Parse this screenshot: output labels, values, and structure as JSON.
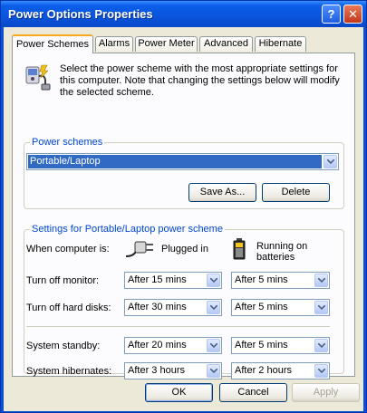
{
  "window": {
    "title": "Power Options Properties"
  },
  "tabs": [
    "Power Schemes",
    "Alarms",
    "Power Meter",
    "Advanced",
    "Hibernate"
  ],
  "intro_text": "Select the power scheme with the most appropriate settings for this computer. Note that changing the settings below will modify the selected scheme.",
  "power_schemes": {
    "legend": "Power schemes",
    "selected": "Portable/Laptop",
    "save_as_label": "Save As...",
    "delete_label": "Delete"
  },
  "settings": {
    "legend": "Settings for Portable/Laptop power scheme",
    "when_label": "When computer is:",
    "plugged_in_label": "Plugged in",
    "batteries_label": "Running on batteries",
    "rows": {
      "monitor": {
        "label": "Turn off monitor:",
        "plugged": "After 15 mins",
        "battery": "After 5 mins"
      },
      "disks": {
        "label": "Turn off hard disks:",
        "plugged": "After 30 mins",
        "battery": "After 5 mins"
      },
      "standby": {
        "label": "System standby:",
        "plugged": "After 20 mins",
        "battery": "After 5 mins"
      },
      "hibernate": {
        "label": "System hibernates:",
        "plugged": "After 3 hours",
        "battery": "After 2 hours"
      }
    }
  },
  "footer": {
    "ok_label": "OK",
    "cancel_label": "Cancel",
    "apply_label": "Apply"
  },
  "colors": {
    "title_bar": "#0a55dd",
    "group_legend": "#0046d5",
    "selection": "#316ac5"
  }
}
